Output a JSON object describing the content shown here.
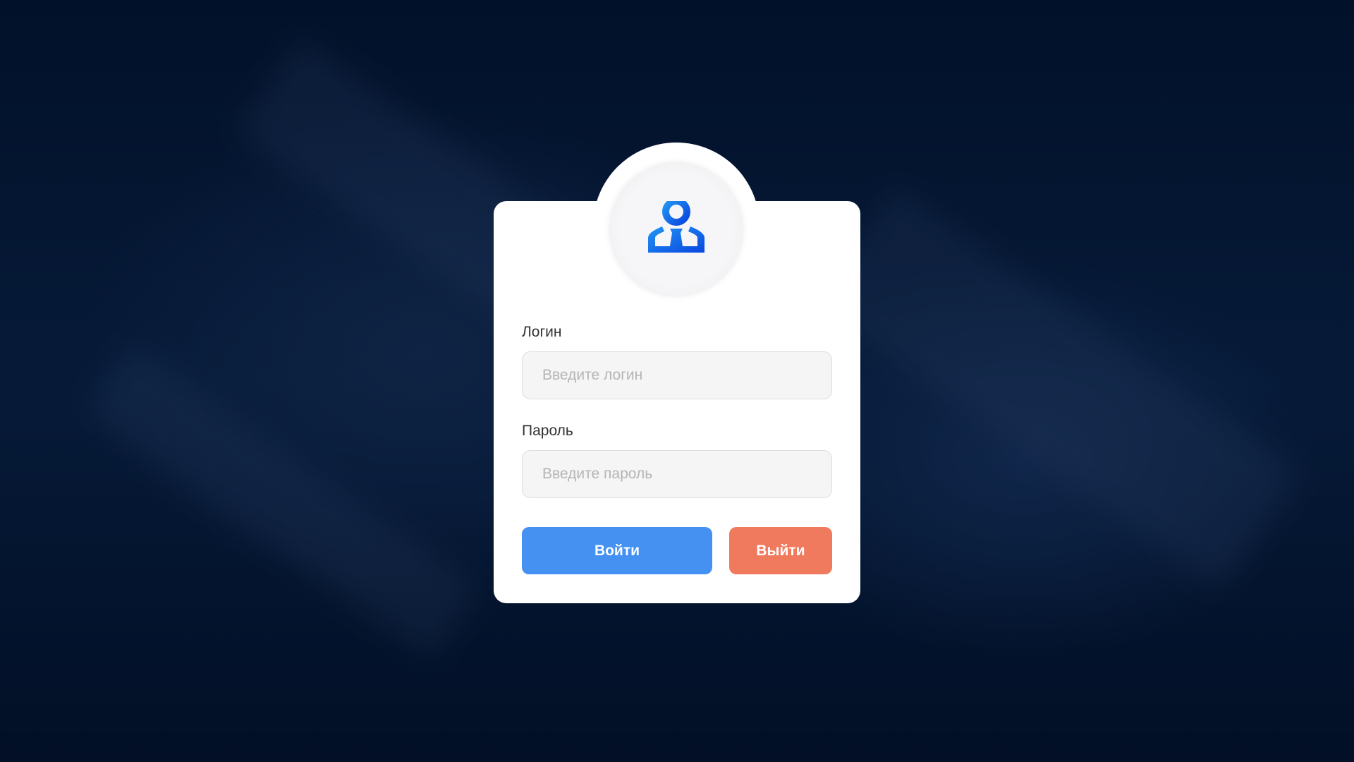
{
  "login": {
    "username_label": "Логин",
    "username_placeholder": "Введите логин",
    "password_label": "Пароль",
    "password_placeholder": "Введите пароль",
    "submit_label": "Войти",
    "exit_label": "Выйти"
  },
  "colors": {
    "primary": "#4491f2",
    "danger": "#f07a5e",
    "icon": "#1a6fe8"
  }
}
